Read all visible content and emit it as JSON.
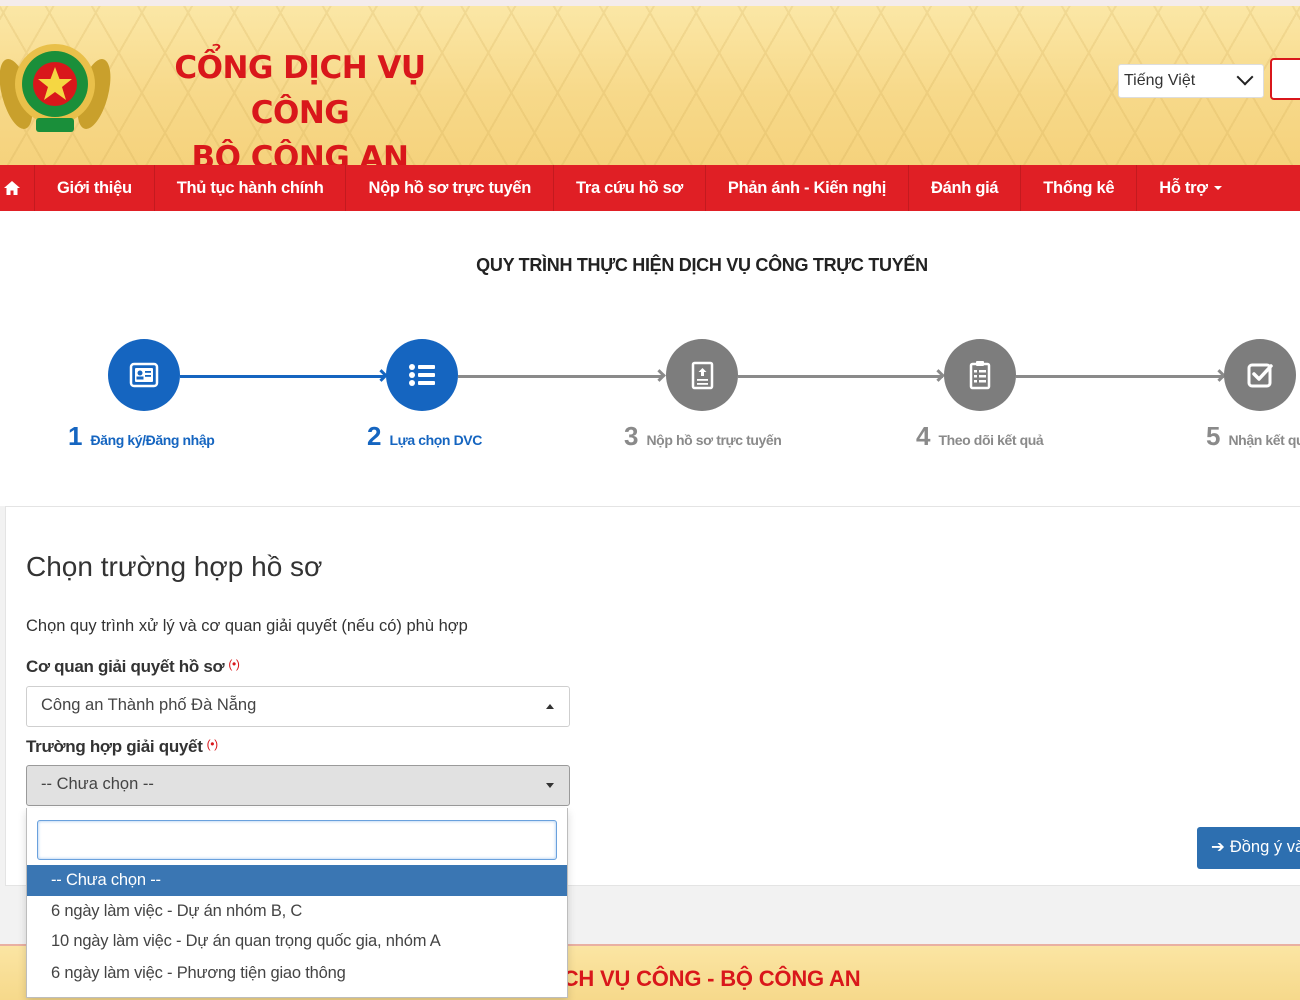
{
  "header": {
    "title_line1": "CỔNG DỊCH VỤ CÔNG",
    "title_line2": "BỘ CÔNG AN",
    "language": "Tiếng Việt",
    "logo_icon": "police-emblem-icon"
  },
  "nav": {
    "home_icon": "home-icon",
    "items": [
      {
        "label": "Giới thiệu"
      },
      {
        "label": "Thủ tục hành chính"
      },
      {
        "label": "Nộp hồ sơ trực tuyến"
      },
      {
        "label": "Tra cứu hồ sơ"
      },
      {
        "label": "Phản ánh - Kiến nghị"
      },
      {
        "label": "Đánh giá"
      },
      {
        "label": "Thống kê"
      },
      {
        "label": "Hỗ trợ"
      }
    ]
  },
  "process": {
    "title": "QUY TRÌNH THỰC HIỆN DỊCH VỤ CÔNG TRỰC TUYẾN",
    "steps": [
      {
        "num": "1",
        "label": "Đăng ký/Đăng nhập",
        "state": "active",
        "icon": "id-card-icon"
      },
      {
        "num": "2",
        "label": "Lựa chọn DVC",
        "state": "active",
        "icon": "list-icon"
      },
      {
        "num": "3",
        "label": "Nộp hồ sơ trực tuyến",
        "state": "inactive",
        "icon": "upload-document-icon"
      },
      {
        "num": "4",
        "label": "Theo dõi kết quả",
        "state": "inactive",
        "icon": "clipboard-icon"
      },
      {
        "num": "5",
        "label": "Nhận kết quả",
        "state": "inactive",
        "icon": "checkbox-icon"
      }
    ]
  },
  "form": {
    "title": "Chọn trường hợp hồ sơ",
    "description": "Chọn quy trình xử lý và cơ quan giải quyết (nếu có) phù hợp",
    "agency_label": "Cơ quan giải quyết hồ sơ",
    "agency_value": "Công an Thành phố Đà Nẵng",
    "case_label": "Trường hợp giải quyết",
    "case_value": "-- Chưa chọn --",
    "required_mark": "(•)",
    "agree_button": "Đồng ý và tiếp tục",
    "dropdown": {
      "search_value": "",
      "options": [
        {
          "label": "-- Chưa chọn --",
          "selected": true
        },
        {
          "label": "6 ngày làm việc - Dự án nhóm B, C",
          "selected": false
        },
        {
          "label": "10 ngày làm việc - Dự án quan trọng quốc gia, nhóm A",
          "selected": false
        },
        {
          "label": "6 ngày làm việc - Phương tiện giao thông",
          "selected": false
        }
      ]
    }
  },
  "footer": {
    "text": "CỔNG DỊCH VỤ CÔNG - BỘ CÔNG AN"
  },
  "colors": {
    "brand_red": "#e01f25",
    "title_red": "#d9171b",
    "active_blue": "#1565c0",
    "inactive_gray": "#7d7d7d",
    "selected_option": "#3a76b3"
  }
}
